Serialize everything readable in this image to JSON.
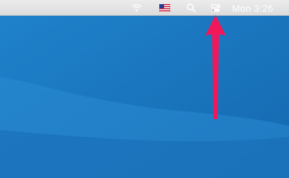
{
  "menubar": {
    "clock": "Mon 3:26",
    "status_icons": [
      "wifi-icon",
      "us-flag-input-icon",
      "spotlight-search-icon",
      "control-center-icon"
    ]
  },
  "colors": {
    "desktop_base": "#1b77bf",
    "menubar": "#e4e4e4",
    "annotation_arrow": "#f0185a"
  }
}
